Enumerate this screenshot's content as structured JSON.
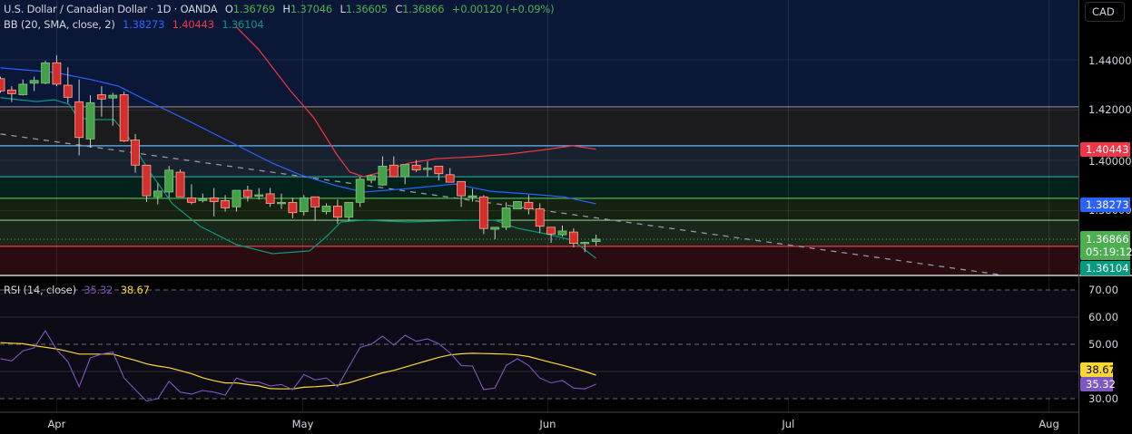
{
  "header": {
    "symbol": "U.S. Dollar / Canadian Dollar · 1D · OANDA",
    "open_label": "O",
    "open": "1.36769",
    "high_label": "H",
    "high": "1.37046",
    "low_label": "L",
    "low": "1.36605",
    "close_label": "C",
    "close": "1.36866",
    "change": "+0.00120 (+0.09%)"
  },
  "bb_legend": {
    "label": "BB (20, SMA, close, 2)",
    "basis": "1.38273",
    "upper": "1.40443",
    "lower": "1.36104"
  },
  "rsi_legend": {
    "label": "RSI (14, close)",
    "rsi": "35.32",
    "ma": "38.67"
  },
  "currency_button": "CAD",
  "price_axis": [
    "1.44000",
    "1.42000",
    "1.40000",
    "1.38000"
  ],
  "price_badges": {
    "upper": "1.40443",
    "basis": "1.38273",
    "last": "1.36866",
    "countdown": "05:19:12",
    "lower": "1.36104"
  },
  "rsi_axis": [
    "70.00",
    "60.00",
    "50.00",
    "30.00"
  ],
  "rsi_badges": {
    "ma": "38.67",
    "rsi": "35.32"
  },
  "time_axis": [
    {
      "label": "Apr",
      "idx": 5
    },
    {
      "label": "May",
      "idx": 26.9
    },
    {
      "label": "Jun",
      "idx": 48.7
    },
    {
      "label": "Jul",
      "idx": 70.1
    },
    {
      "label": "Aug",
      "idx": 93.3
    }
  ],
  "colors": {
    "up": "#4caf50",
    "down": "#e53935",
    "bb_upper": "#f23645",
    "bb_basis": "#2962ff",
    "bb_lower": "#089981",
    "rsi": "#7e57c2",
    "rsi_ma": "#fdd835",
    "bg": "#000000"
  },
  "chart_data": {
    "type": "candlestick",
    "title": "U.S. Dollar / Canadian Dollar · 1D · OANDA",
    "ylim": [
      1.3518,
      1.4637
    ],
    "price_ticks": [
      1.44,
      1.42,
      1.4,
      1.38
    ],
    "candles": [
      [
        1.4325,
        1.4333,
        1.4269,
        1.4276
      ],
      [
        1.428,
        1.4295,
        1.4232,
        1.4265
      ],
      [
        1.4261,
        1.4322,
        1.4258,
        1.4303
      ],
      [
        1.4307,
        1.4333,
        1.4276,
        1.4318
      ],
      [
        1.4307,
        1.4396,
        1.4303,
        1.4388
      ],
      [
        1.4388,
        1.4418,
        1.4295,
        1.4303
      ],
      [
        1.4299,
        1.437,
        1.4228,
        1.4251
      ],
      [
        1.4233,
        1.4322,
        1.402,
        1.4091
      ],
      [
        1.4085,
        1.4259,
        1.4051,
        1.4229
      ],
      [
        1.4261,
        1.4295,
        1.4174,
        1.4244
      ],
      [
        1.4248,
        1.4269,
        1.4138,
        1.4259
      ],
      [
        1.4261,
        1.4273,
        1.4073,
        1.4077
      ],
      [
        1.4081,
        1.4105,
        1.3951,
        1.3981
      ],
      [
        1.3981,
        1.3981,
        1.3835,
        1.3859
      ],
      [
        1.3855,
        1.3909,
        1.3825,
        1.3878
      ],
      [
        1.3874,
        1.3978,
        1.3851,
        1.3961
      ],
      [
        1.3953,
        1.3964,
        1.3855,
        1.3855
      ],
      [
        1.3851,
        1.3905,
        1.3825,
        1.3833
      ],
      [
        1.384,
        1.3868,
        1.3833,
        1.3847
      ],
      [
        1.3851,
        1.389,
        1.3777,
        1.3836
      ],
      [
        1.384,
        1.3862,
        1.3796,
        1.3811
      ],
      [
        1.3815,
        1.3881,
        1.3796,
        1.3881
      ],
      [
        1.3881,
        1.3899,
        1.3836,
        1.3855
      ],
      [
        1.3859,
        1.389,
        1.3844,
        1.3863
      ],
      [
        1.3867,
        1.389,
        1.3815,
        1.3829
      ],
      [
        1.3833,
        1.3868,
        1.3807,
        1.3833
      ],
      [
        1.3833,
        1.3851,
        1.377,
        1.3792
      ],
      [
        1.3796,
        1.3862,
        1.3781,
        1.3851
      ],
      [
        1.3855,
        1.3855,
        1.3759,
        1.3815
      ],
      [
        1.3796,
        1.3829,
        1.3785,
        1.3818
      ],
      [
        1.3818,
        1.3844,
        1.3748,
        1.3774
      ],
      [
        1.3774,
        1.3833,
        1.3759,
        1.3833
      ],
      [
        1.3833,
        1.3935,
        1.3815,
        1.3925
      ],
      [
        1.3921,
        1.3943,
        1.3909,
        1.3939
      ],
      [
        1.3902,
        1.4016,
        1.3899,
        1.3977
      ],
      [
        1.3981,
        1.4016,
        1.3935,
        1.3935
      ],
      [
        1.3935,
        1.3984,
        1.3905,
        1.3984
      ],
      [
        1.3981,
        1.4001,
        1.3953,
        1.3962
      ],
      [
        1.3966,
        1.3997,
        1.3935,
        1.3969
      ],
      [
        1.3977,
        1.3977,
        1.392,
        1.3947
      ],
      [
        1.3943,
        1.3969,
        1.3913,
        1.3913
      ],
      [
        1.3916,
        1.3916,
        1.3815,
        1.3859
      ],
      [
        1.3855,
        1.3887,
        1.3836,
        1.3859
      ],
      [
        1.3855,
        1.3862,
        1.3707,
        1.3729
      ],
      [
        1.3726,
        1.3734,
        1.3686,
        1.3734
      ],
      [
        1.3734,
        1.3833,
        1.3723,
        1.3811
      ],
      [
        1.3807,
        1.3836,
        1.3807,
        1.3836
      ],
      [
        1.3833,
        1.3862,
        1.3785,
        1.3807
      ],
      [
        1.3807,
        1.3829,
        1.3711,
        1.3738
      ],
      [
        1.3734,
        1.3734,
        1.3672,
        1.3707
      ],
      [
        1.3704,
        1.3741,
        1.3697,
        1.3719
      ],
      [
        1.3715,
        1.373,
        1.3654,
        1.367
      ],
      [
        1.367,
        1.3677,
        1.3635,
        1.3674
      ],
      [
        1.36769,
        1.37046,
        1.36605,
        1.36866
      ]
    ],
    "bollinger": {
      "upper": [
        [
          21,
          1.453
        ],
        [
          23,
          1.444
        ],
        [
          25.8,
          1.4277
        ],
        [
          27.9,
          1.4169
        ],
        [
          29.9,
          1.4025
        ],
        [
          31.1,
          1.3953
        ],
        [
          32.3,
          1.3935
        ],
        [
          33.9,
          1.3953
        ],
        [
          36.3,
          1.3989
        ],
        [
          38.8,
          1.4007
        ],
        [
          42,
          1.4014
        ],
        [
          45.2,
          1.4025
        ],
        [
          48.5,
          1.4043
        ],
        [
          50.9,
          1.4058
        ],
        [
          53,
          1.40443
        ]
      ],
      "basis": [
        [
          0,
          1.4368
        ],
        [
          4.8,
          1.435
        ],
        [
          8.1,
          1.4321
        ],
        [
          10.5,
          1.4295
        ],
        [
          13.7,
          1.4223
        ],
        [
          16.2,
          1.4169
        ],
        [
          20.2,
          1.4079
        ],
        [
          24.2,
          1.3989
        ],
        [
          26.7,
          1.3942
        ],
        [
          29.9,
          1.3899
        ],
        [
          32.3,
          1.3874
        ],
        [
          36.3,
          1.3888
        ],
        [
          40.4,
          1.3906
        ],
        [
          43.6,
          1.3877
        ],
        [
          46.8,
          1.3867
        ],
        [
          50.1,
          1.3855
        ],
        [
          53,
          1.38273
        ]
      ],
      "lower": [
        [
          0,
          1.4249
        ],
        [
          3.2,
          1.4234
        ],
        [
          4.8,
          1.4241
        ],
        [
          6.1,
          1.4223
        ],
        [
          6.9,
          1.4169
        ],
        [
          8.1,
          1.4162
        ],
        [
          10.1,
          1.4162
        ],
        [
          11.3,
          1.4097
        ],
        [
          13.3,
          1.3953
        ],
        [
          15.3,
          1.3827
        ],
        [
          17.8,
          1.3737
        ],
        [
          21,
          1.3665
        ],
        [
          24.2,
          1.3629
        ],
        [
          27.5,
          1.364
        ],
        [
          29.1,
          1.3701
        ],
        [
          30.3,
          1.3755
        ],
        [
          32.3,
          1.3762
        ],
        [
          36.3,
          1.3755
        ],
        [
          42,
          1.3762
        ],
        [
          44,
          1.3762
        ],
        [
          46,
          1.373
        ],
        [
          48.5,
          1.3708
        ],
        [
          50.9,
          1.3683
        ],
        [
          53,
          1.36104
        ]
      ]
    },
    "levels": [
      {
        "price": 1.4213,
        "color": "#787b86",
        "fill": "#1b1b1d"
      },
      {
        "price": 1.4058,
        "color": "#64b5f6",
        "fill": "#18222f"
      },
      {
        "price": 1.3935,
        "color": "#26a69a",
        "fill": "#03201b"
      },
      {
        "price": 1.3849,
        "color": "#4caf50",
        "fill": "#15220f"
      },
      {
        "price": 1.3762,
        "color": "#81c784",
        "fill": "#192619"
      },
      {
        "price": 1.3658,
        "color": "#f23645",
        "fill": "#2a0b10"
      }
    ],
    "top_fill": "#0b1736",
    "trendline": [
      [
        0,
        1.4105
      ],
      [
        88.8,
        1.3546
      ]
    ],
    "last_price": 1.36866,
    "rsi": {
      "ylim": [
        24.3,
        75
      ],
      "levels": [
        70,
        50,
        30
      ],
      "grid": [
        60,
        40
      ],
      "values": [
        44.7,
        43.9,
        47.6,
        48.7,
        55,
        48,
        43.6,
        34.4,
        45,
        46.4,
        47.2,
        37.6,
        33.3,
        29.1,
        30,
        36.4,
        32.4,
        31.7,
        33,
        32.4,
        31.3,
        37.6,
        36.1,
        36.1,
        34.7,
        35.2,
        33.3,
        38.9,
        36.9,
        37.6,
        34.4,
        41.7,
        48.9,
        50,
        53,
        49.7,
        53.3,
        51.1,
        52,
        50.2,
        46.9,
        42.2,
        42,
        33.3,
        33.9,
        42.2,
        44.7,
        42.2,
        37.6,
        35.8,
        36.7,
        33.9,
        33.6,
        35.32
      ],
      "ma": [
        50.6,
        50.4,
        50.2,
        49.5,
        48.9,
        48.3,
        47.4,
        46.4,
        46.4,
        46.4,
        46.4,
        45.2,
        44.1,
        42.8,
        42,
        41.4,
        40.3,
        39.2,
        37.7,
        36.6,
        35.8,
        35.8,
        35.2,
        34.7,
        33.7,
        33.6,
        33.6,
        34.2,
        34.4,
        34.7,
        35,
        35.8,
        37.1,
        38.3,
        39.5,
        40.4,
        41.6,
        42.8,
        44,
        45.2,
        46.1,
        46.5,
        46.7,
        46.6,
        46.5,
        46.4,
        46.1,
        45.5,
        44.4,
        43.3,
        42.3,
        41.2,
        40,
        38.67
      ]
    }
  }
}
